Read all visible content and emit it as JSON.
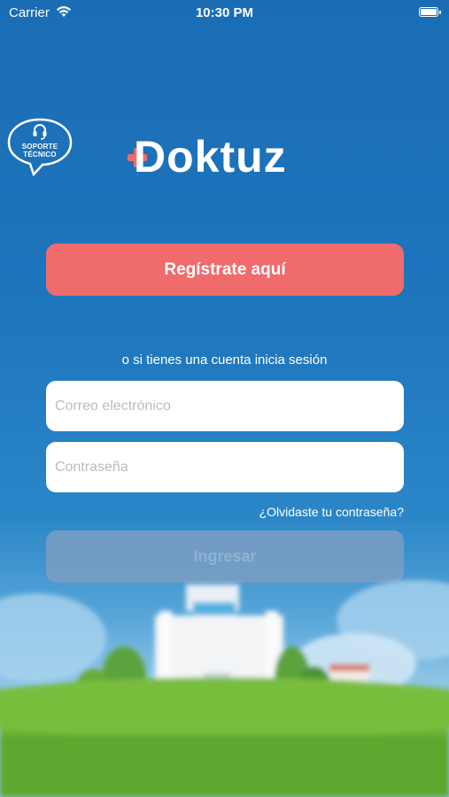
{
  "status_bar": {
    "carrier": "Carrier",
    "time": "10:30 PM"
  },
  "support": {
    "line1": "SOPORTE",
    "line2": "TÉCNICO"
  },
  "logo": {
    "text": "Doktuz"
  },
  "register_button": "Regístrate aquí",
  "login_hint": "o si tienes una cuenta inicia sesión",
  "email_field": {
    "placeholder": "Correo electrónico",
    "value": ""
  },
  "password_field": {
    "placeholder": "Contraseña",
    "value": ""
  },
  "forgot_password": "¿Olvidaste tu contraseña?",
  "submit_button": "Ingresar",
  "colors": {
    "primary": "#f06b6c",
    "background": "#1e76bd",
    "disabled_button": "#7b9ec2"
  }
}
